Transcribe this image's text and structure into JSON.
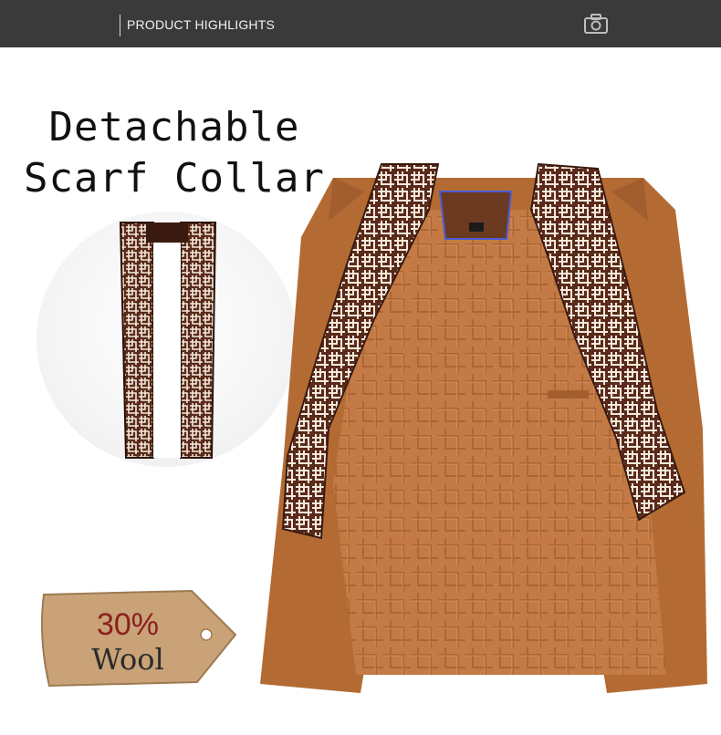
{
  "header": {
    "title": "PRODUCT HIGHLIGHTS",
    "icon": "camera-icon",
    "background": "#3a3a3a"
  },
  "headline": {
    "line1": "Detachable",
    "line2": "Scarf Collar"
  },
  "tag": {
    "percent": "30%",
    "material": "Wool"
  },
  "colors": {
    "coat_wool": "#b36b33",
    "lining": "#c47a45",
    "scarf_dark": "#5a2a1a",
    "scarf_light": "#f3e9dc",
    "tag": "#c9a278",
    "tag_text_red": "#8a1f1f"
  }
}
